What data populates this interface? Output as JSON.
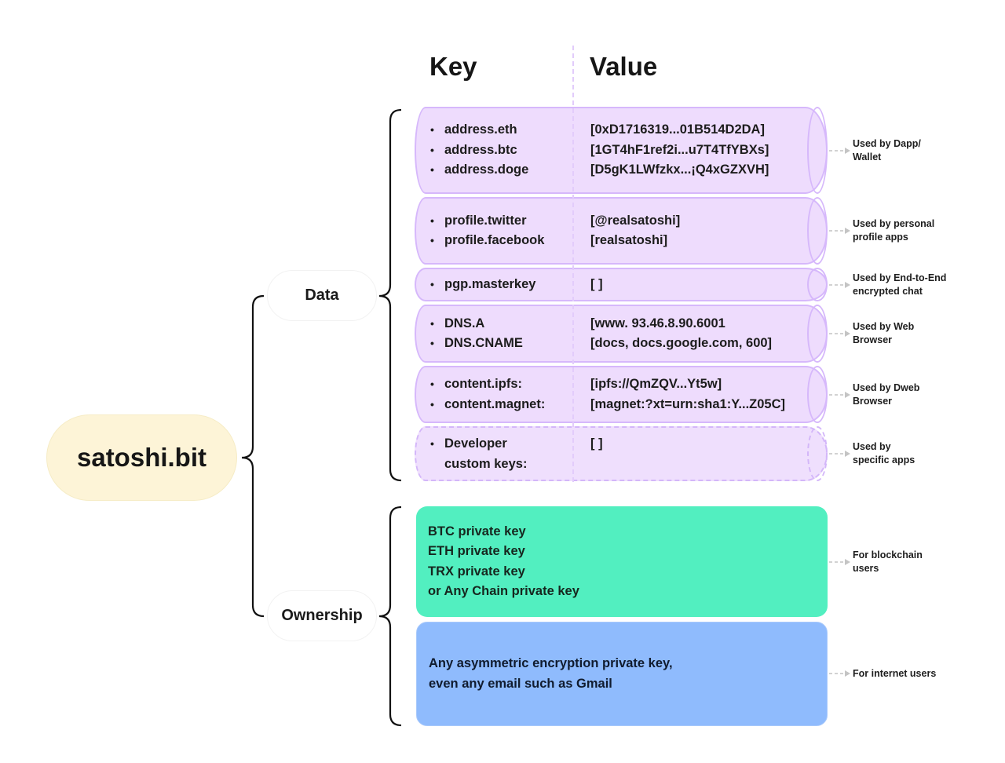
{
  "root": {
    "label": "satoshi.bit"
  },
  "branches": {
    "data": {
      "label": "Data"
    },
    "ownership": {
      "label": "Ownership"
    }
  },
  "headers": {
    "key": "Key",
    "value": "Value"
  },
  "data_rows": [
    {
      "keys": [
        "address.eth",
        "address.btc",
        "address.doge"
      ],
      "values": [
        "[0xD1716319...01B514D2DA]",
        "[1GT4hF1ref2i...u7T4TfYBXs]",
        "[D5gK1LWfzkx...¡Q4xGZXVH]"
      ],
      "usage": [
        "Used by Dapp/",
        "Wallet"
      ],
      "style": "solid"
    },
    {
      "keys": [
        "profile.twitter",
        "profile.facebook"
      ],
      "values": [
        "[@realsatoshi]",
        "[realsatoshi]"
      ],
      "usage": [
        "Used by personal",
        "profile apps"
      ],
      "style": "solid"
    },
    {
      "keys": [
        "pgp.masterkey"
      ],
      "values": [
        "[ ]"
      ],
      "usage": [
        "Used by End-to-End",
        "encrypted chat"
      ],
      "style": "solid"
    },
    {
      "keys": [
        "DNS.A",
        "DNS.CNAME"
      ],
      "values": [
        "[www. 93.46.8.90.6001",
        "[docs, docs.google.com, 600]"
      ],
      "usage": [
        "Used by Web",
        "Browser"
      ],
      "style": "solid"
    },
    {
      "keys": [
        "content.ipfs:",
        "content.magnet:"
      ],
      "values": [
        "[ipfs://QmZQV...Yt5w]",
        "[magnet:?xt=urn:sha1:Y...Z05C]"
      ],
      "usage": [
        "Used by Dweb",
        "Browser"
      ],
      "style": "solid"
    },
    {
      "keys": [
        "Developer",
        "custom keys:"
      ],
      "values": [
        "[ ]"
      ],
      "usage": [
        "Used by",
        "specific apps"
      ],
      "style": "dashed"
    }
  ],
  "ownership_rows": [
    {
      "lines": [
        "BTC private key",
        "ETH private key",
        "TRX private key",
        "or Any Chain private key"
      ],
      "usage": [
        "For blockchain",
        "users"
      ],
      "color": "#52efc0"
    },
    {
      "lines": [
        "Any asymmetric encryption private key,",
        "even any email such as Gmail"
      ],
      "usage": [
        "For internet users"
      ],
      "color": "#8fbbfd"
    }
  ]
}
